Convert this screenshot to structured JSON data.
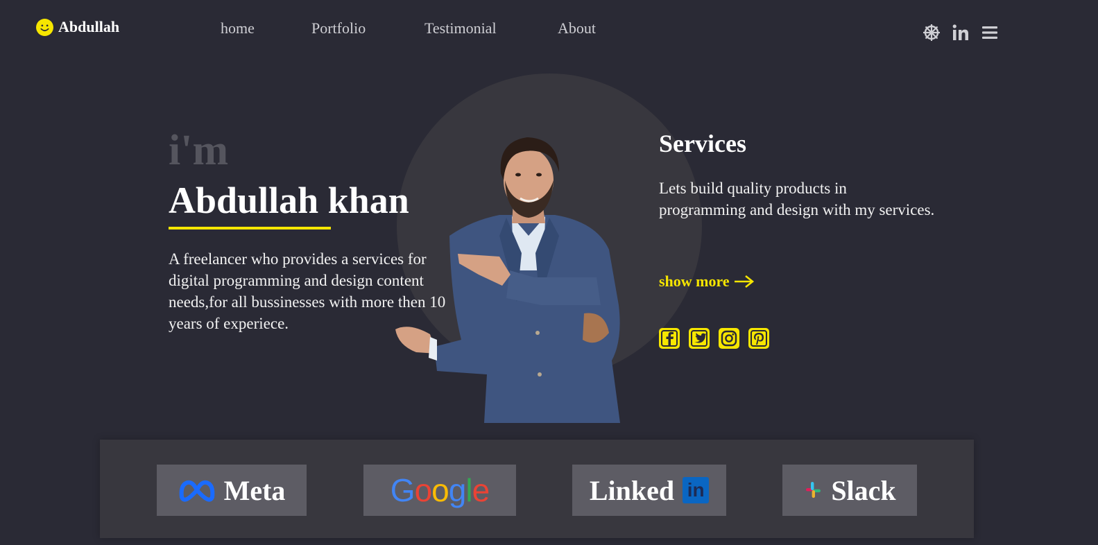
{
  "header": {
    "logo_text": "Abdullah",
    "logo_icon": "smiley-icon",
    "nav": [
      "home",
      "Portfolio",
      "Testimonial",
      "About"
    ],
    "icons": [
      "dharma-wheel-icon",
      "linkedin-icon",
      "menu-icon"
    ]
  },
  "hero": {
    "intro": "i'm",
    "name": "Abdullah khan",
    "description": "A freelancer who provides a services for digital programming and design content needs,for all bussinesses with more then 10 years of experiece."
  },
  "services": {
    "title": "Services",
    "text": "Lets build quality products in programming and design with my services.",
    "show_more": "show more",
    "social_icons": [
      "facebook-icon",
      "twitter-icon",
      "instagram-icon",
      "pinterest-icon"
    ]
  },
  "brands": {
    "meta": "Meta",
    "google": [
      "G",
      "o",
      "o",
      "g",
      "l",
      "e"
    ],
    "linkedin": "Linked",
    "linkedin_badge": "in",
    "slack": "Slack"
  },
  "colors": {
    "background": "#2a2a35",
    "accent": "#f6e600",
    "circle": "#38373e",
    "brand_tile": "#5d5c64"
  }
}
